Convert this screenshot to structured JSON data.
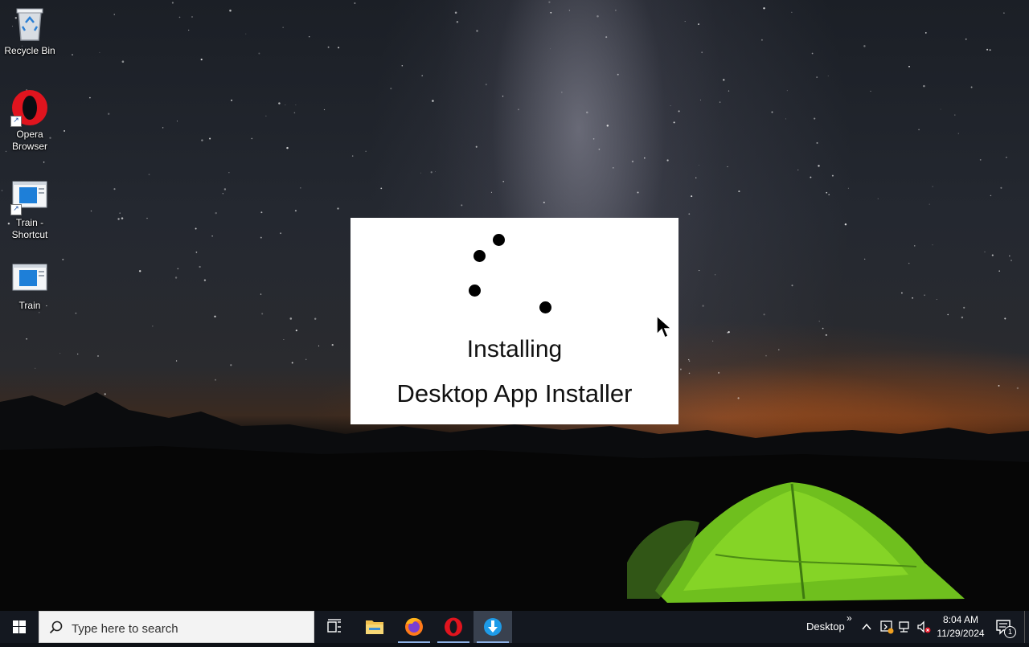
{
  "desktop": {
    "icons": [
      {
        "label": "Recycle Bin",
        "icon": "recycle-bin-icon"
      },
      {
        "label": "Opera Browser",
        "icon": "opera-icon"
      },
      {
        "label": "Train - Shortcut",
        "icon": "app-window-icon"
      },
      {
        "label": "Train",
        "icon": "app-window-icon"
      }
    ]
  },
  "installer": {
    "status": "Installing",
    "app_name": "Desktop App Installer"
  },
  "taskbar": {
    "search_placeholder": "Type here to search",
    "pinned": [
      {
        "name": "task-view-icon"
      },
      {
        "name": "file-explorer-icon"
      },
      {
        "name": "firefox-icon"
      },
      {
        "name": "opera-icon"
      },
      {
        "name": "app-installer-icon"
      }
    ],
    "toolbar_label": "Desktop",
    "toolbar_chevron": "»",
    "clock": {
      "time": "8:04 AM",
      "date": "11/29/2024"
    },
    "notification_count": "1"
  },
  "colors": {
    "taskbar": "#141820",
    "opera_red": "#e0141e",
    "installer_blue": "#1e9be8"
  }
}
